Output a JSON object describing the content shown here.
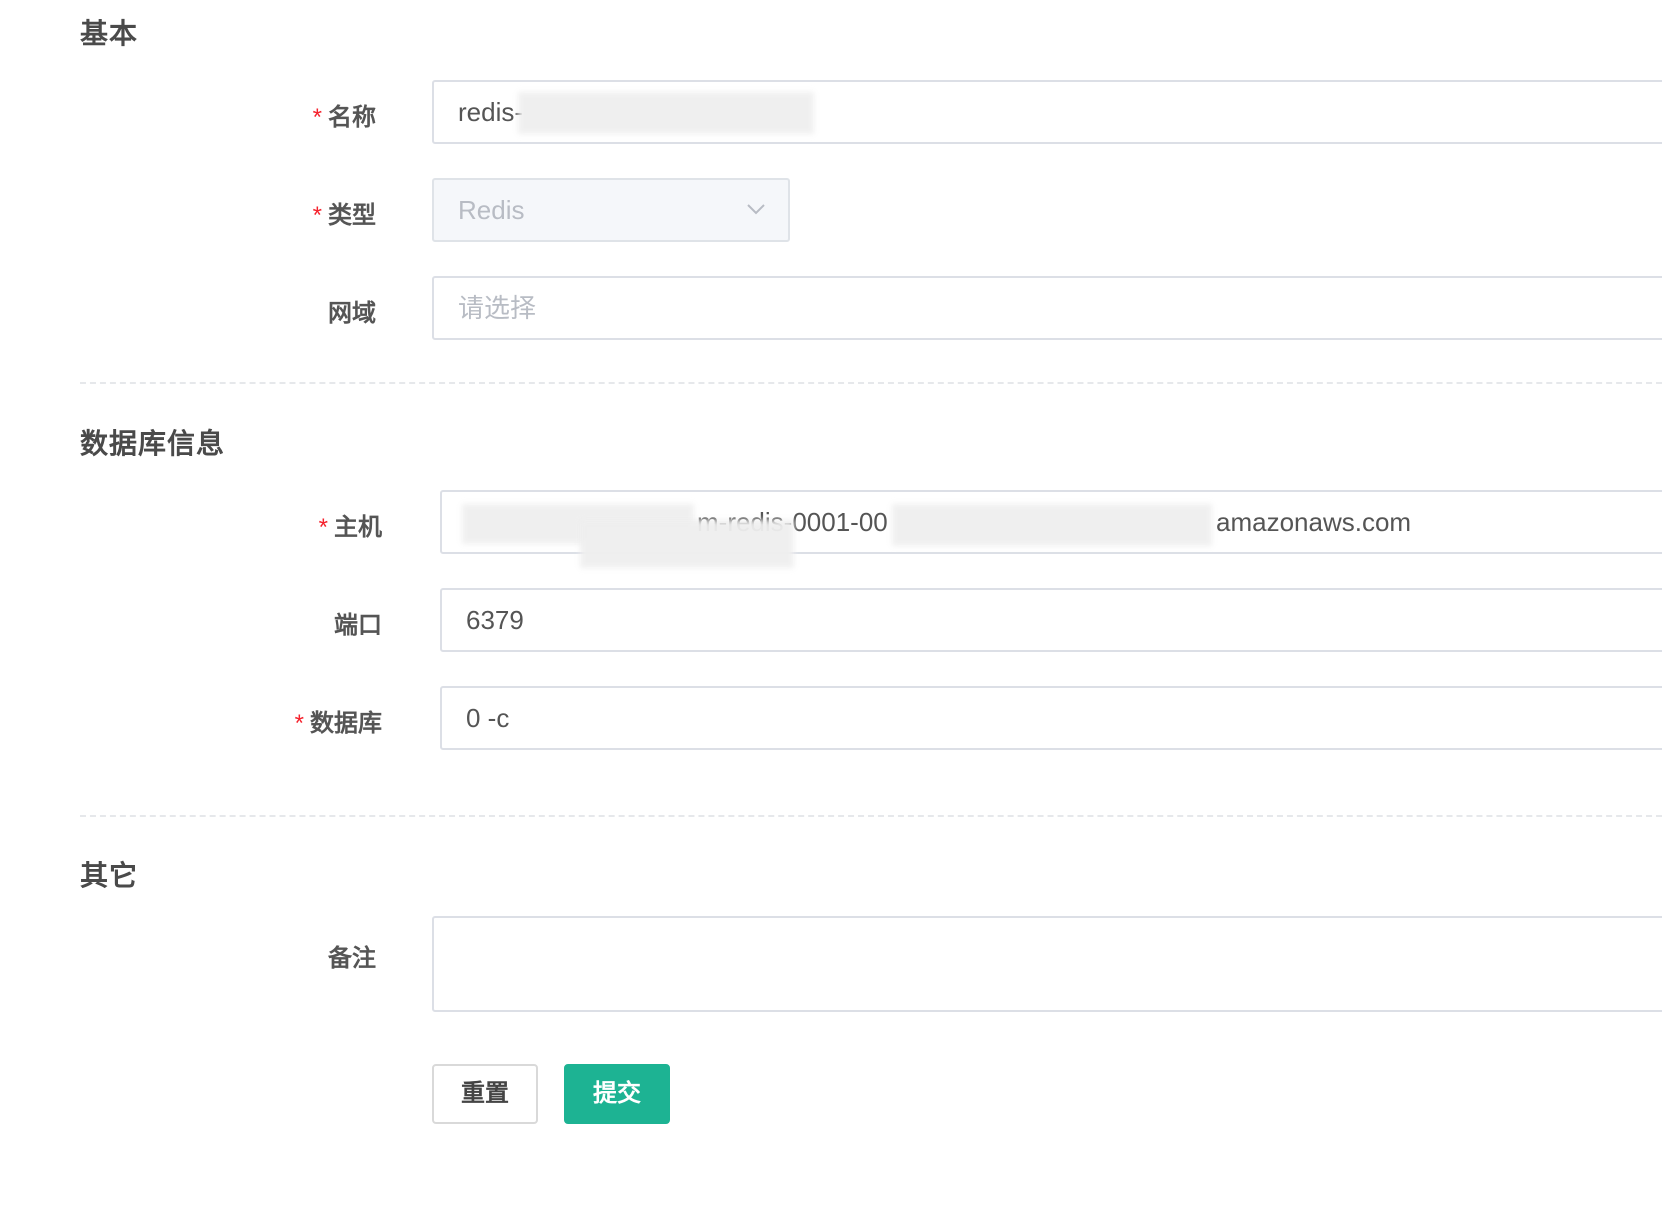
{
  "sections": {
    "basic": {
      "title": "基本"
    },
    "database": {
      "title": "数据库信息"
    },
    "other": {
      "title": "其它"
    }
  },
  "form": {
    "name": {
      "label": "名称",
      "required_mark": "*",
      "value": "redis-"
    },
    "type": {
      "label": "类型",
      "required_mark": "*",
      "value": "Redis",
      "icon": "chevron-down-icon"
    },
    "domain": {
      "label": "网域",
      "placeholder": "请选择"
    },
    "host": {
      "label": "主机",
      "required_mark": "*",
      "value_middle": "m-redis-0001-00",
      "value_end": "amazonaws.com"
    },
    "port": {
      "label": "端口",
      "value": "6379"
    },
    "database": {
      "label": "数据库",
      "required_mark": "*",
      "value": "0 -c"
    },
    "remark": {
      "label": "备注",
      "value": ""
    }
  },
  "actions": {
    "reset_label": "重置",
    "submit_label": "提交"
  },
  "colors": {
    "primary": "#1db393",
    "required": "#f5222d",
    "border": "#dcdfe6"
  }
}
